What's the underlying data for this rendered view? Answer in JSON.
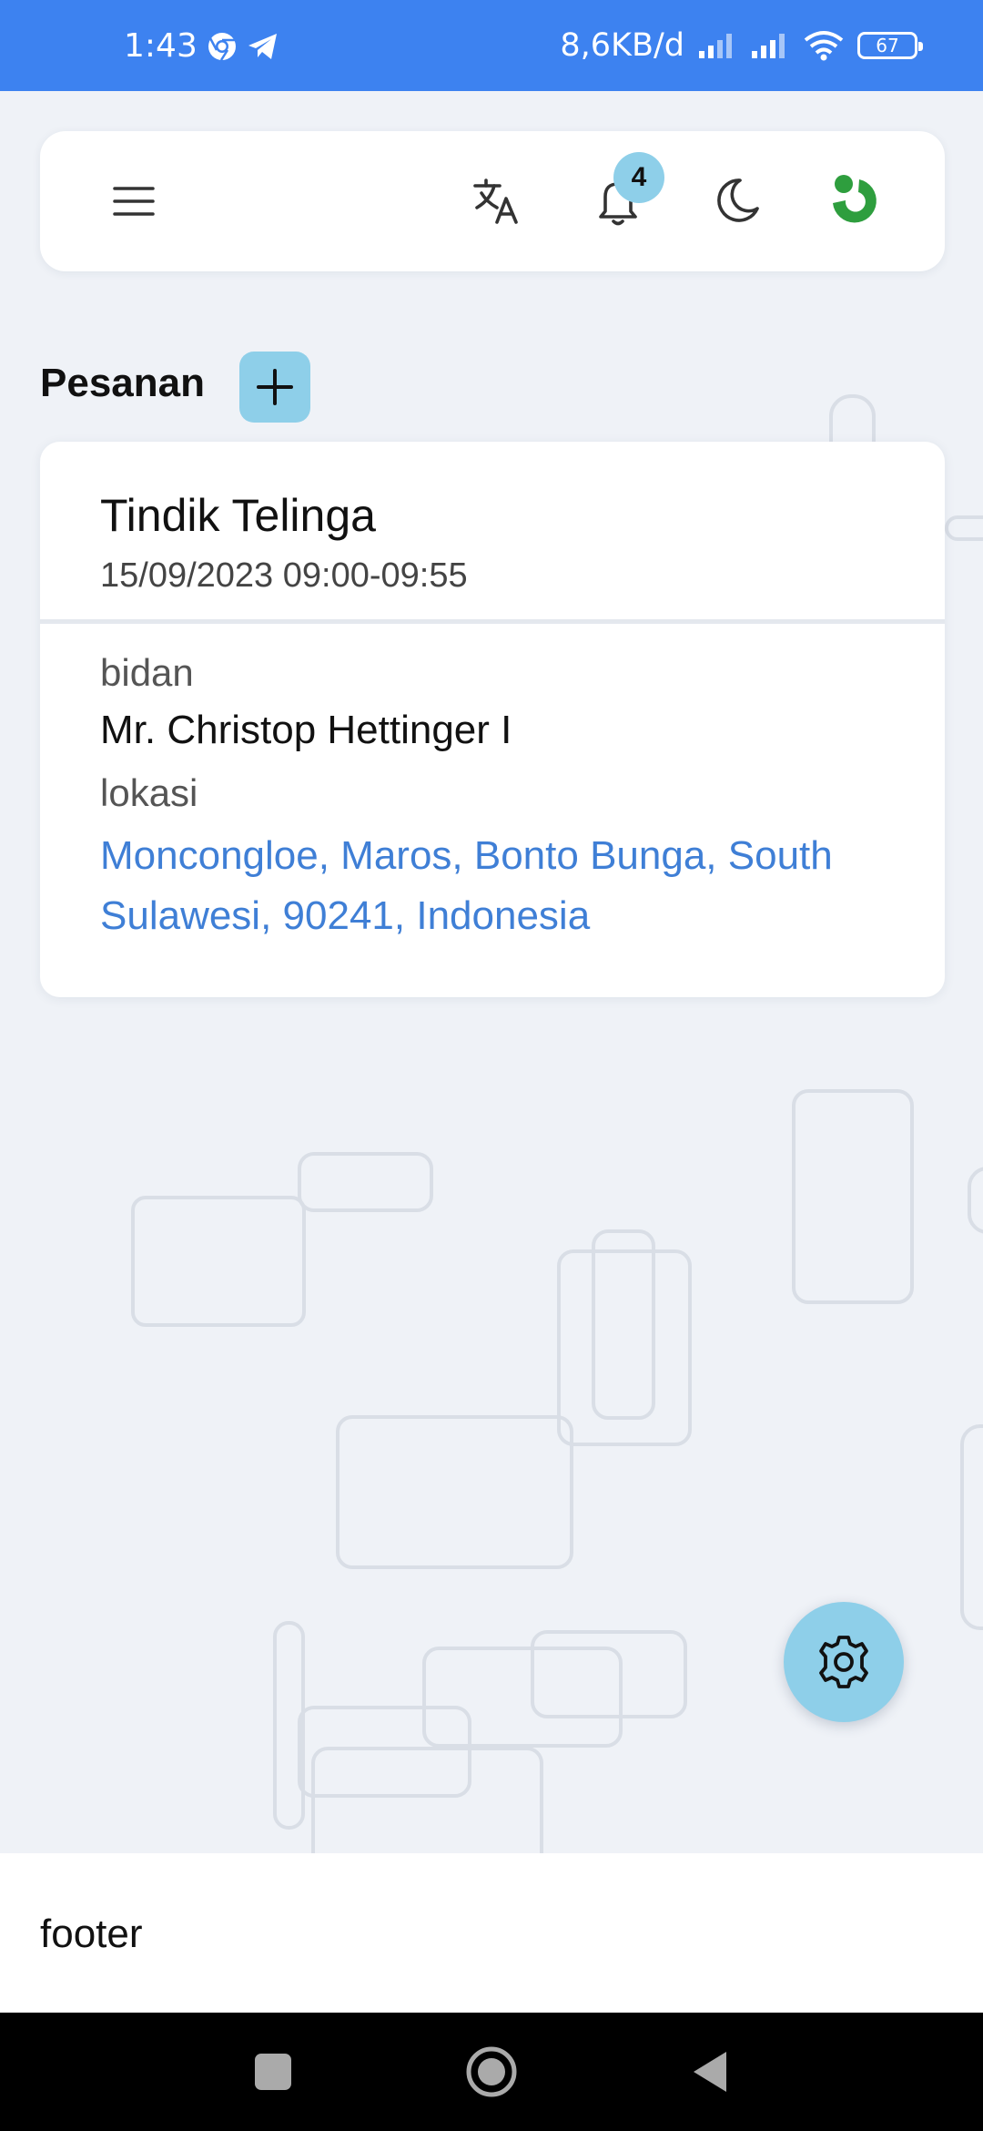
{
  "status_bar": {
    "time": "1:43",
    "net_speed": "8,6KB/d",
    "battery": "67",
    "icons": [
      "chrome-icon",
      "telegram-icon",
      "signal-icon",
      "signal-icon",
      "wifi-icon",
      "battery-icon"
    ],
    "color": "#3d82f0"
  },
  "topbar": {
    "icons": [
      "menu-icon",
      "translate-icon",
      "bell-icon",
      "moon-icon",
      "avatar-logo-icon"
    ],
    "notification_count": "4"
  },
  "orders": {
    "title": "Pesanan",
    "add_icon": "plus-icon",
    "items": [
      {
        "title": "Tindik Telinga",
        "datetime": "15/09/2023 09:00-09:55",
        "midwife_label": "bidan",
        "midwife": "Mr. Christop Hettinger I",
        "location_label": "lokasi",
        "location": "Moncongloe, Maros, Bonto Bunga, South Sulawesi, 90241, Indonesia"
      }
    ]
  },
  "fab": {
    "icon": "gear-icon"
  },
  "footer": {
    "text": "footer"
  },
  "navigation": {
    "icons": [
      "recents-square-icon",
      "home-circle-icon",
      "back-triangle-icon"
    ]
  },
  "colors": {
    "accent": "#8ecfe9",
    "link": "#3f7fd6",
    "background": "#eff2f7",
    "logo_green": "#2e9e3e"
  }
}
